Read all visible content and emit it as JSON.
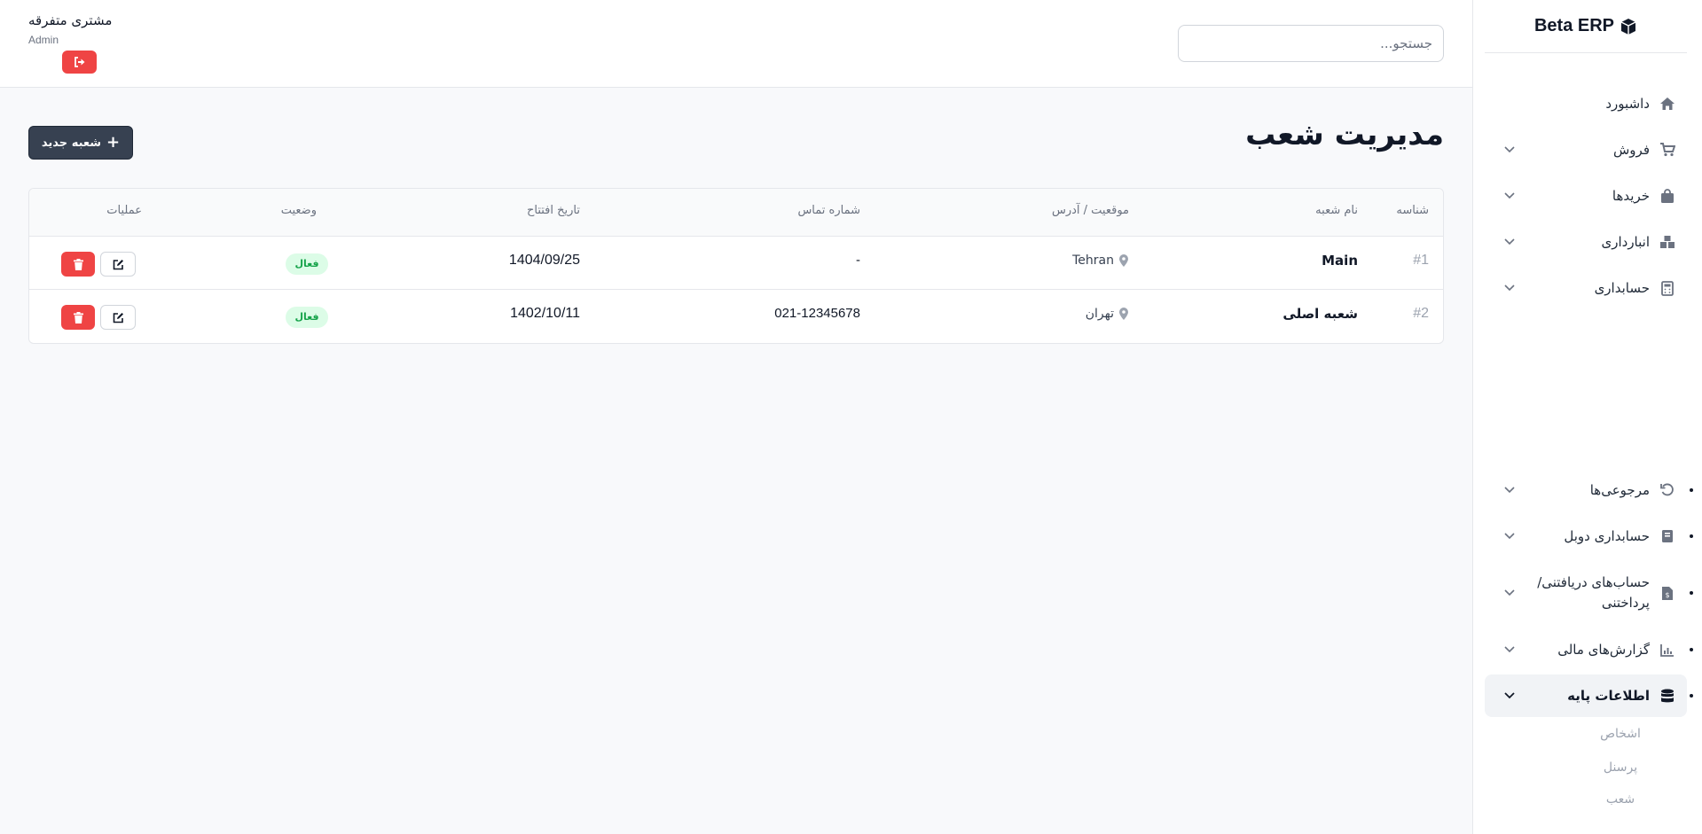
{
  "app": {
    "brand": "Beta ERP"
  },
  "sidebar": {
    "items": [
      {
        "label": "داشبورد",
        "icon": "home-icon"
      },
      {
        "label": "فروش",
        "icon": "cart-icon"
      },
      {
        "label": "خریدها",
        "icon": "bag-icon"
      },
      {
        "label": "انبارداری",
        "icon": "warehouse-icon"
      },
      {
        "label": "حسابداری",
        "icon": "calculator-icon"
      },
      {
        "label": "مرجوعی‌ها",
        "icon": "undo-icon"
      },
      {
        "label": "حسابداری دوبل",
        "icon": "book-icon"
      },
      {
        "label": "حساب‌های دریافتنی/پرداختنی",
        "label_line1": "حساب‌های دریافتنی/",
        "label_line2": "پرداختنی",
        "icon": "invoice-icon"
      },
      {
        "label": "گزارش‌های مالی",
        "icon": "chart-icon"
      },
      {
        "label": "اطلاعات پایه",
        "icon": "database-icon",
        "active": true
      }
    ],
    "sub_items": [
      "اشخاص",
      "پرسنل",
      "شعب"
    ]
  },
  "header": {
    "search_placeholder": "جستجو...",
    "user_name": "مشتری متفرقه",
    "user_role": "Admin"
  },
  "main": {
    "title": "مدیریت شعب",
    "new_button_label": "شعبه جدید",
    "table": {
      "columns": [
        "شناسه",
        "نام شعبه",
        "موقعیت / آدرس",
        "شماره تماس",
        "تاریخ افتتاح",
        "وضعیت",
        "عملیات"
      ],
      "rows": [
        {
          "id": "#1",
          "name": "Main",
          "location": "Tehran",
          "phone": "-",
          "opened": "1404/09/25",
          "status": "فعال"
        },
        {
          "id": "#2",
          "name": "شعبه اصلی",
          "location": "تهران",
          "phone": "021-12345678",
          "opened": "1402/10/11",
          "status": "فعال"
        }
      ]
    }
  },
  "colors": {
    "primary_button": "#374151",
    "danger": "#ef4444",
    "status_active_bg": "#dcfce7",
    "status_active_text": "#16a34a"
  }
}
